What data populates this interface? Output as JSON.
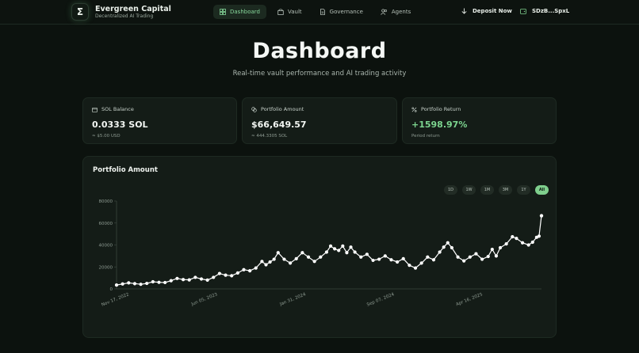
{
  "brand": {
    "name": "Evergreen Capital",
    "tagline": "Decentralized AI Trading",
    "logo_glyph": "Σ"
  },
  "nav": {
    "tabs": [
      {
        "label": "Dashboard",
        "icon": "grid-icon",
        "active": true
      },
      {
        "label": "Vault",
        "icon": "vault-icon",
        "active": false
      },
      {
        "label": "Governance",
        "icon": "document-icon",
        "active": false
      },
      {
        "label": "Agents",
        "icon": "users-icon",
        "active": false
      }
    ],
    "deposit_label": "Deposit Now",
    "wallet_label": "SDzB...SpxL"
  },
  "page": {
    "title": "Dashboard",
    "subtitle": "Real-time vault performance and AI trading activity"
  },
  "cards": [
    {
      "label": "SOL Balance",
      "icon": "wallet-icon",
      "value": "0.0333 SOL",
      "sub": "≈ $5.00 USD"
    },
    {
      "label": "Portfolio Amount",
      "icon": "coins-icon",
      "value": "$66,649.57",
      "sub": "≈ 444.3305 SOL"
    },
    {
      "label": "Portfolio Return",
      "icon": "percent-icon",
      "value": "+1598.97%",
      "sub": "Period return"
    }
  ],
  "chart_section": {
    "title": "Portfolio Amount",
    "ranges": [
      "1D",
      "1W",
      "1M",
      "3M",
      "1Y",
      "All"
    ],
    "active_range": "All"
  },
  "colors": {
    "accent": "#7fcf8d",
    "background": "#0c120e",
    "card": "#141c17",
    "line": "#ffffff"
  },
  "chart_data": {
    "type": "line",
    "ylim": [
      0,
      80000
    ],
    "yticks": [
      0,
      20000,
      40000,
      60000,
      80000
    ],
    "xtick_labels": [
      "Nov 17, 2022",
      "Jun 05, 2023",
      "Jan 31, 2024",
      "Sep 07, 2024",
      "Apr 16, 2025"
    ],
    "grid": false,
    "series": [
      {
        "points": [
          [
            0,
            3500
          ],
          [
            1.5,
            4500
          ],
          [
            3,
            5500
          ],
          [
            4.5,
            4800
          ],
          [
            6,
            4200
          ],
          [
            7.5,
            5000
          ],
          [
            9,
            6500
          ],
          [
            10.5,
            6000
          ],
          [
            12,
            5800
          ],
          [
            13.5,
            7500
          ],
          [
            15,
            9500
          ],
          [
            16.5,
            8500
          ],
          [
            18,
            8200
          ],
          [
            19.5,
            10500
          ],
          [
            21,
            9000
          ],
          [
            22.5,
            8000
          ],
          [
            24,
            10500
          ],
          [
            25.5,
            14000
          ],
          [
            27,
            12500
          ],
          [
            28.5,
            12000
          ],
          [
            30,
            14500
          ],
          [
            31.5,
            17500
          ],
          [
            33,
            16500
          ],
          [
            34.5,
            19000
          ],
          [
            36,
            25000
          ],
          [
            37,
            22000
          ],
          [
            38,
            24500
          ],
          [
            39,
            27000
          ],
          [
            40,
            33000
          ],
          [
            41.5,
            27000
          ],
          [
            43,
            23500
          ],
          [
            44.5,
            27500
          ],
          [
            46,
            33000
          ],
          [
            47.5,
            29000
          ],
          [
            49,
            25000
          ],
          [
            50.5,
            29000
          ],
          [
            52,
            33500
          ],
          [
            53,
            39000
          ],
          [
            54,
            36500
          ],
          [
            55,
            35000
          ],
          [
            56,
            39000
          ],
          [
            57,
            33000
          ],
          [
            58,
            38000
          ],
          [
            59,
            33500
          ],
          [
            60.5,
            29000
          ],
          [
            62,
            31500
          ],
          [
            63.5,
            26000
          ],
          [
            65,
            27000
          ],
          [
            66.5,
            30000
          ],
          [
            68,
            26500
          ],
          [
            69.5,
            24500
          ],
          [
            71,
            27500
          ],
          [
            72.5,
            21500
          ],
          [
            74,
            19000
          ],
          [
            75.5,
            23500
          ],
          [
            77,
            29000
          ],
          [
            78.5,
            26500
          ],
          [
            80,
            33500
          ],
          [
            81,
            38000
          ],
          [
            82,
            42000
          ],
          [
            83,
            37500
          ],
          [
            84.5,
            29000
          ],
          [
            86,
            25500
          ],
          [
            87.5,
            29000
          ],
          [
            89,
            32000
          ],
          [
            90.5,
            27000
          ],
          [
            92,
            29500
          ],
          [
            93,
            36000
          ],
          [
            94,
            30000
          ],
          [
            95,
            37500
          ],
          [
            96.5,
            41000
          ],
          [
            98,
            47500
          ],
          [
            99,
            46000
          ],
          [
            100.5,
            42000
          ],
          [
            102,
            40000
          ],
          [
            103,
            42500
          ],
          [
            104,
            47000
          ],
          [
            104.6,
            48000
          ],
          [
            105.2,
            66649.57
          ]
        ]
      }
    ]
  }
}
